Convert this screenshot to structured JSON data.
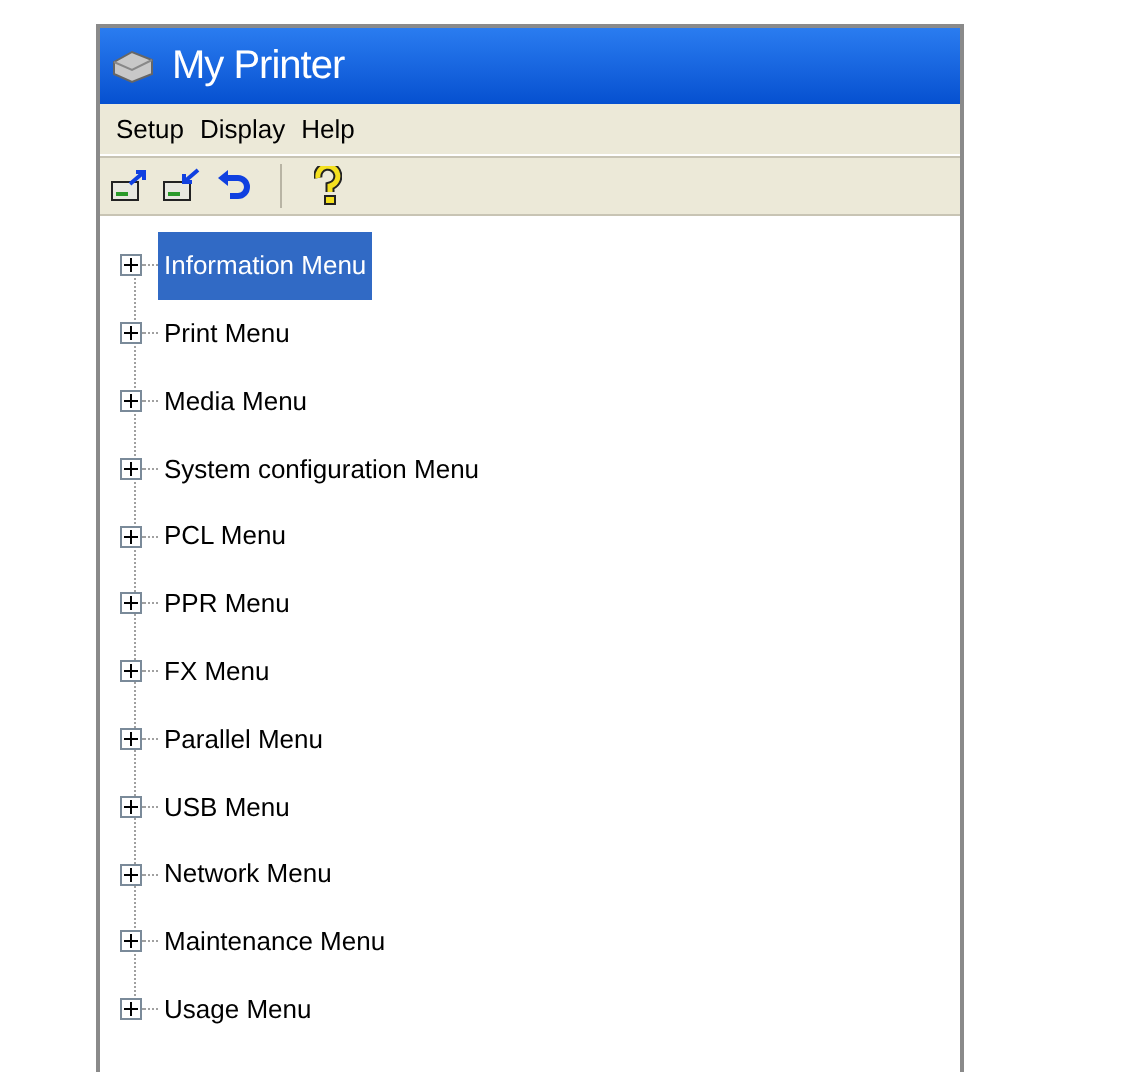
{
  "window": {
    "title": "My Printer"
  },
  "menu_bar": [
    "Setup",
    "Display",
    "Help"
  ],
  "toolbar": [
    {
      "kind": "upload"
    },
    {
      "kind": "download"
    },
    {
      "kind": "undo"
    },
    {
      "kind": "separator"
    },
    {
      "kind": "help"
    }
  ],
  "tree": {
    "items": [
      {
        "label": "Information Menu",
        "selected": true,
        "expanded": false
      },
      {
        "label": "Print Menu",
        "selected": false,
        "expanded": false
      },
      {
        "label": "Media Menu",
        "selected": false,
        "expanded": false
      },
      {
        "label": "System configuration Menu",
        "selected": false,
        "expanded": false
      },
      {
        "label": "PCL Menu",
        "selected": false,
        "expanded": false
      },
      {
        "label": "PPR Menu",
        "selected": false,
        "expanded": false
      },
      {
        "label": "FX Menu",
        "selected": false,
        "expanded": false
      },
      {
        "label": "Parallel Menu",
        "selected": false,
        "expanded": false
      },
      {
        "label": "USB Menu",
        "selected": false,
        "expanded": false
      },
      {
        "label": "Network Menu",
        "selected": false,
        "expanded": false
      },
      {
        "label": "Maintenance Menu",
        "selected": false,
        "expanded": false
      },
      {
        "label": "Usage Menu",
        "selected": false,
        "expanded": false
      }
    ]
  }
}
